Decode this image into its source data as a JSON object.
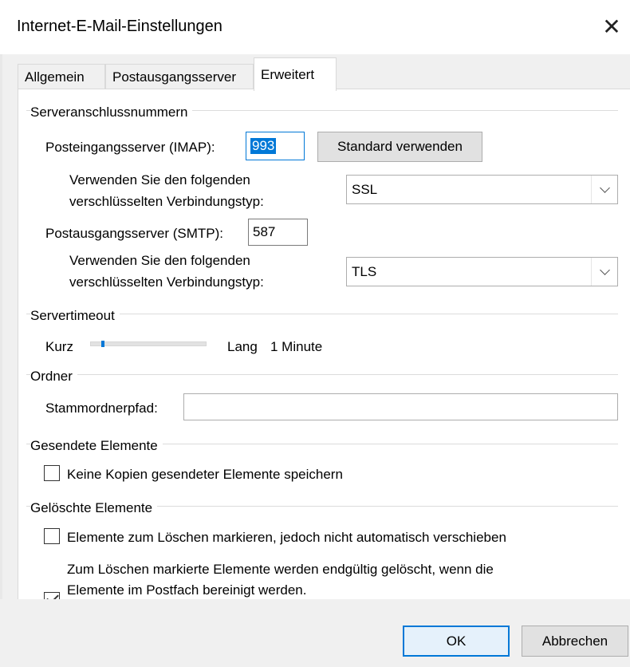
{
  "window": {
    "title": "Internet-E-Mail-Einstellungen",
    "close_glyph": "✕"
  },
  "tabs": [
    {
      "label": "Allgemein",
      "active": false
    },
    {
      "label": "Postausgangsserver",
      "active": false
    },
    {
      "label": "Erweitert",
      "active": true
    }
  ],
  "server_ports": {
    "title": "Serveranschlussnummern",
    "incoming_label": "Posteingangsserver (IMAP):",
    "incoming_value": "993",
    "default_button": "Standard verwenden",
    "encryption_label_1a": "Verwenden Sie den folgenden",
    "encryption_label_1b": "verschlüsselten Verbindungstyp:",
    "incoming_encryption": "SSL",
    "outgoing_label": "Postausgangsserver (SMTP):",
    "outgoing_value": "587",
    "encryption_label_2a": "Verwenden Sie den folgenden",
    "encryption_label_2b": "verschlüsselten Verbindungstyp:",
    "outgoing_encryption": "TLS"
  },
  "timeout": {
    "title": "Servertimeout",
    "short_label": "Kurz",
    "long_label": "Lang",
    "value_text": "1 Minute",
    "level_fraction": 0.1
  },
  "folders": {
    "title": "Ordner",
    "root_path_label": "Stammordnerpfad:",
    "root_path_value": ""
  },
  "sent_items": {
    "title": "Gesendete Elemente",
    "no_copies_label": "Keine Kopien gesendeter Elemente speichern",
    "no_copies_checked": false
  },
  "deleted_items": {
    "title": "Gelöschte Elemente",
    "mark_label": "Elemente zum Löschen markieren, jedoch nicht automatisch verschieben",
    "mark_checked": false,
    "info_line1": "Zum Löschen markierte Elemente werden endgültig gelöscht, wenn die",
    "info_line2": "Elemente im Postfach bereinigt werden."
  },
  "footer": {
    "ok_label": "OK",
    "cancel_label": "Abbrechen"
  },
  "icons": {
    "close": "close-icon",
    "dropdown": "chevron-down-icon",
    "check": "checkmark-icon"
  },
  "colors": {
    "accent": "#0078d7",
    "panel_bg": "#ffffff",
    "window_bg": "#f0f0f0"
  }
}
